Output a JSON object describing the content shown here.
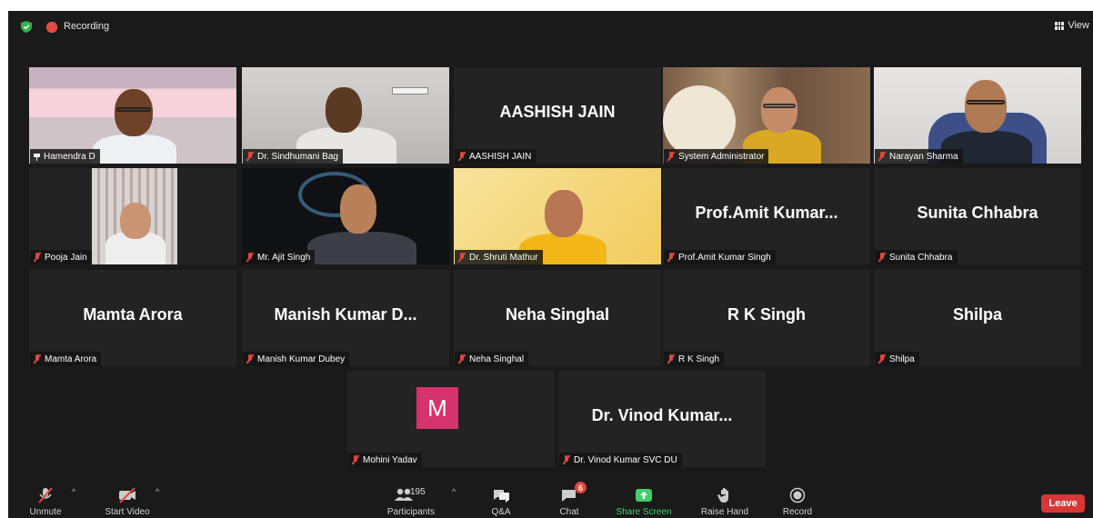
{
  "topbar": {
    "recording_label": "Recording",
    "view_label": "View"
  },
  "tiles": [
    {
      "name": "Hamendra D",
      "center": "",
      "video": true
    },
    {
      "name": "Dr. Sindhumani Bag",
      "center": "",
      "video": true
    },
    {
      "name": "AASHISH JAIN",
      "center": "AASHISH JAIN",
      "video": false
    },
    {
      "name": "System Administrator",
      "center": "",
      "video": true
    },
    {
      "name": "Narayan Sharma",
      "center": "",
      "video": true
    },
    {
      "name": "Pooja Jain",
      "center": "",
      "video": true
    },
    {
      "name": "Mr. Ajit Singh",
      "center": "",
      "video": true
    },
    {
      "name": "Dr. Shruti Mathur",
      "center": "",
      "video": true
    },
    {
      "name": "Prof.Amit Kumar Singh",
      "center": "Prof.Amit  Kumar...",
      "video": false
    },
    {
      "name": "Sunita Chhabra",
      "center": "Sunita Chhabra",
      "video": false
    },
    {
      "name": "Mamta Arora",
      "center": "Mamta Arora",
      "video": false
    },
    {
      "name": "Manish Kumar Dubey",
      "center": "Manish  Kumar  D...",
      "video": false
    },
    {
      "name": "Neha Singhal",
      "center": "Neha Singhal",
      "video": false
    },
    {
      "name": "R K Singh",
      "center": "R K Singh",
      "video": false
    },
    {
      "name": "Shilpa",
      "center": "Shilpa",
      "video": false
    },
    {
      "name": "Mohini Yadav",
      "center": "",
      "avatar_letter": "M",
      "video": false
    },
    {
      "name": "Dr. Vinod Kumar SVC DU",
      "center": "Dr.  Vinod  Kumar...",
      "video": false
    }
  ],
  "toolbar": {
    "unmute": "Unmute",
    "start_video": "Start Video",
    "participants": "Participants",
    "participants_count": "195",
    "qa": "Q&A",
    "chat": "Chat",
    "chat_badge": "6",
    "share_screen": "Share Screen",
    "raise_hand": "Raise Hand",
    "record": "Record",
    "leave": "Leave"
  },
  "colors": {
    "active_speaker": "#d3e85a",
    "share_green": "#3ecf6c",
    "leave_red": "#d93636",
    "avatar_pink": "#d6336c"
  }
}
